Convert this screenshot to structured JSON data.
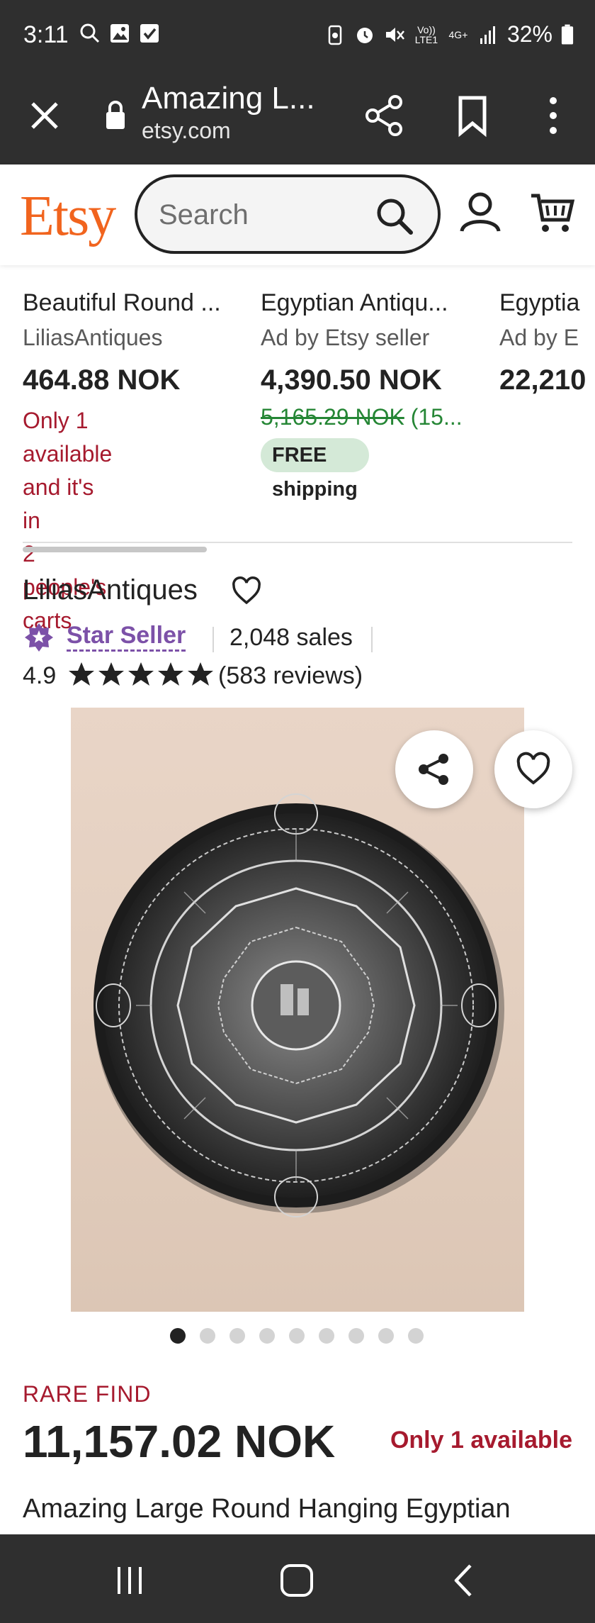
{
  "status_bar": {
    "time": "3:11",
    "volte": "Vo)) LTE1",
    "network": "4G+",
    "battery": "32%"
  },
  "browser": {
    "page_title": "Amazing L...",
    "domain": "etsy.com",
    "icons": [
      "close-icon",
      "lock-icon",
      "share-icon",
      "bookmark-icon",
      "more-icon"
    ]
  },
  "header": {
    "logo": "Etsy",
    "search_placeholder": "Search"
  },
  "recommendations": [
    {
      "title": "Beautiful Round ...",
      "seller": "LiliasAntiques",
      "price": "464.88 NOK",
      "availability_lines": [
        "Only 1 available",
        "and it's in",
        "2 people's carts"
      ]
    },
    {
      "title": "Egyptian Antiqu...",
      "seller": "Ad by Etsy seller",
      "price": "4,390.50 NOK",
      "old_price": "5,165.29 NOK",
      "discount": " (15...",
      "badge": "FREE shipping"
    },
    {
      "title": "Egyptia",
      "seller": "Ad by E",
      "price": "22,210"
    }
  ],
  "shop": {
    "name": "LiliasAntiques",
    "badge": "Star Seller",
    "sales": "2,048 sales",
    "rating": "4.9",
    "stars": 5,
    "reviews": "(583 reviews)"
  },
  "gallery": {
    "count": 9,
    "active_index": 0
  },
  "product": {
    "tag": "RARE FIND",
    "price": "11,157.02 NOK",
    "availability": "Only 1 available",
    "title": "Amazing Large Round Hanging Egyptian"
  },
  "colors": {
    "etsy_orange": "#f1641e",
    "availability_red": "#a61a2e",
    "star_seller_purple": "#7c51a8",
    "discount_green": "#258635",
    "free_shipping_bg": "#d4e9d7",
    "system_bar": "#2f2f2f"
  }
}
